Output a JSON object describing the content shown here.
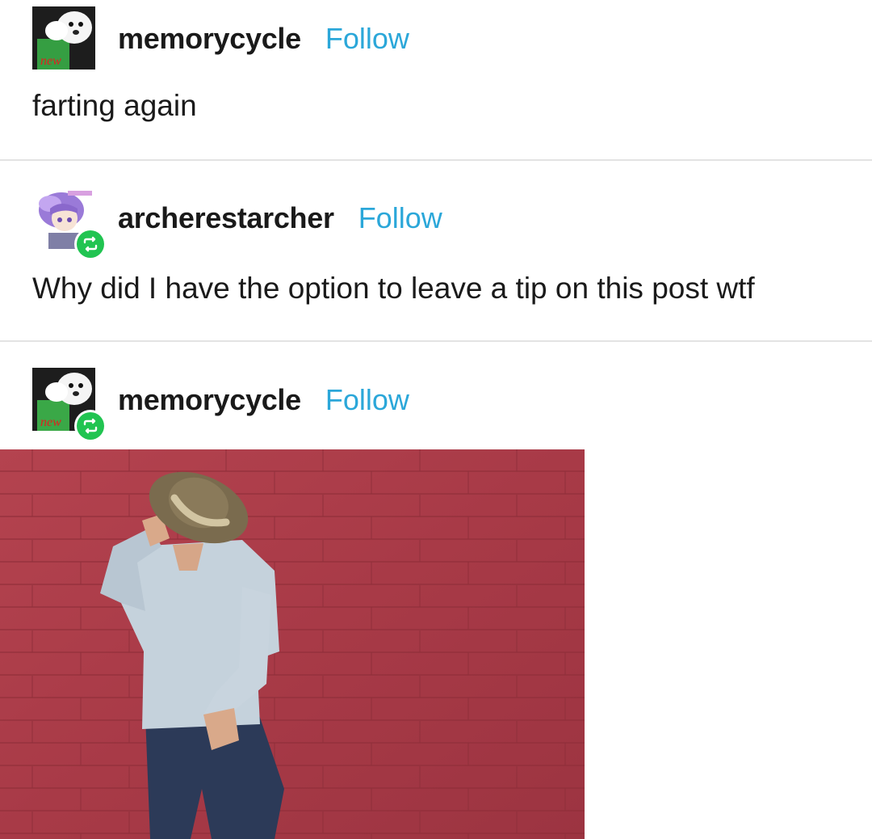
{
  "posts": [
    {
      "username": "memorycycle",
      "follow_label": "Follow",
      "avatar_icon": "dew-bottle-dog-avatar",
      "text": "farting again",
      "is_reblog": false
    },
    {
      "username": "archerestarcher",
      "follow_label": "Follow",
      "avatar_icon": "purple-hair-anime-avatar",
      "text": "Why did I have the option to leave a tip on this post wtf",
      "is_reblog": true
    },
    {
      "username": "memorycycle",
      "follow_label": "Follow",
      "avatar_icon": "dew-bottle-dog-avatar",
      "is_reblog": true,
      "image_icon": "man-in-hat-against-red-brick-wall-photo"
    }
  ],
  "colors": {
    "follow": "#2ba7d9",
    "reblog_badge": "#21c451",
    "text": "#1a1a1a",
    "divider": "#e3e3e3",
    "brick_wall": "#b0424c"
  }
}
